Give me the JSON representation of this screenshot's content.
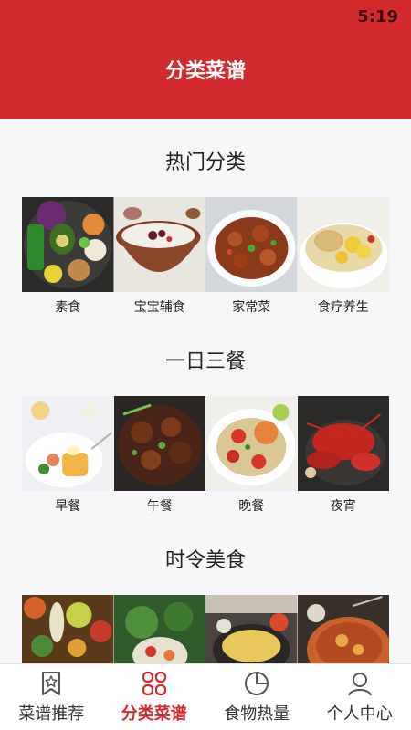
{
  "status_bar": {
    "time": "5:19"
  },
  "header": {
    "title": "分类菜谱"
  },
  "sections": [
    {
      "title": "热门分类",
      "items": [
        "素食",
        "宝宝辅食",
        "家常菜",
        "食疗养生"
      ]
    },
    {
      "title": "一日三餐",
      "items": [
        "早餐",
        "午餐",
        "晚餐",
        "夜宵"
      ]
    },
    {
      "title": "时令美食",
      "items": [
        "",
        "",
        "",
        ""
      ]
    }
  ],
  "tabs": [
    {
      "label": "菜谱推荐",
      "icon": "bookmark-star-icon",
      "active": false
    },
    {
      "label": "分类菜谱",
      "icon": "grid-icon",
      "active": true
    },
    {
      "label": "食物热量",
      "icon": "pie-chart-icon",
      "active": false
    },
    {
      "label": "个人中心",
      "icon": "person-icon",
      "active": false
    }
  ],
  "colors": {
    "accent": "#d32a2e",
    "background": "#f7f7f9"
  }
}
